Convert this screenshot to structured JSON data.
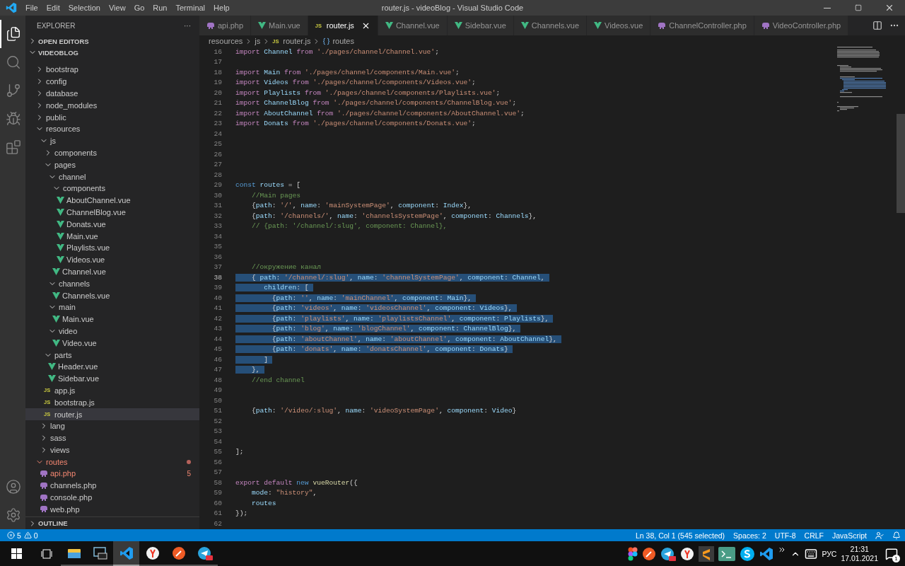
{
  "window": {
    "title": "router.js - videoBlog - Visual Studio Code"
  },
  "menu": [
    "File",
    "Edit",
    "Selection",
    "View",
    "Go",
    "Run",
    "Terminal",
    "Help"
  ],
  "activity_bar": [
    {
      "kind": "files",
      "selected": true
    },
    {
      "kind": "search",
      "selected": false
    },
    {
      "kind": "git",
      "selected": false
    },
    {
      "kind": "debug",
      "selected": false
    },
    {
      "kind": "extensions",
      "selected": false
    }
  ],
  "sidebar": {
    "title": "EXPLORER",
    "more": "···",
    "sections": [
      {
        "label": "OPEN EDITORS",
        "expanded": false
      },
      {
        "label": "VIDEOBLOG",
        "expanded": true
      }
    ],
    "tree": [
      {
        "label": "bootstrap",
        "kind": "folder",
        "expanded": false,
        "selected": false,
        "error": false
      },
      {
        "label": "config",
        "kind": "folder",
        "expanded": false,
        "selected": false,
        "error": false
      },
      {
        "label": "database",
        "kind": "folder",
        "expanded": false,
        "selected": false,
        "error": false
      },
      {
        "label": "node_modules",
        "kind": "folder",
        "expanded": false,
        "selected": false,
        "error": false
      },
      {
        "label": "public",
        "kind": "folder",
        "expanded": false,
        "selected": false,
        "error": false
      },
      {
        "label": "resources",
        "kind": "folder",
        "expanded": true,
        "selected": false,
        "error": false,
        "children": [
          {
            "label": "js",
            "kind": "folder",
            "expanded": true,
            "selected": false,
            "error": false,
            "children": [
              {
                "label": "components",
                "kind": "folder",
                "expanded": false,
                "selected": false,
                "error": false
              },
              {
                "label": "pages",
                "kind": "folder",
                "expanded": true,
                "selected": false,
                "error": false,
                "children": [
                  {
                    "label": "channel",
                    "kind": "folder",
                    "expanded": true,
                    "selected": false,
                    "error": false,
                    "children": [
                      {
                        "label": "components",
                        "kind": "folder",
                        "expanded": true,
                        "selected": false,
                        "error": false,
                        "children": [
                          {
                            "label": "AboutChannel.vue",
                            "kind": "vue",
                            "selected": false,
                            "error": false
                          },
                          {
                            "label": "ChannelBlog.vue",
                            "kind": "vue",
                            "selected": false,
                            "error": false
                          },
                          {
                            "label": "Donats.vue",
                            "kind": "vue",
                            "selected": false,
                            "error": false
                          },
                          {
                            "label": "Main.vue",
                            "kind": "vue",
                            "selected": false,
                            "error": false
                          },
                          {
                            "label": "Playlists.vue",
                            "kind": "vue",
                            "selected": false,
                            "error": false
                          },
                          {
                            "label": "Videos.vue",
                            "kind": "vue",
                            "selected": false,
                            "error": false
                          }
                        ]
                      },
                      {
                        "label": "Channel.vue",
                        "kind": "vue",
                        "selected": false,
                        "error": false
                      }
                    ]
                  },
                  {
                    "label": "channels",
                    "kind": "folder",
                    "expanded": true,
                    "selected": false,
                    "error": false,
                    "children": [
                      {
                        "label": "Channels.vue",
                        "kind": "vue",
                        "selected": false,
                        "error": false
                      }
                    ]
                  },
                  {
                    "label": "main",
                    "kind": "folder",
                    "expanded": true,
                    "selected": false,
                    "error": false,
                    "children": [
                      {
                        "label": "Main.vue",
                        "kind": "vue",
                        "selected": false,
                        "error": false
                      }
                    ]
                  },
                  {
                    "label": "video",
                    "kind": "folder",
                    "expanded": true,
                    "selected": false,
                    "error": false,
                    "children": [
                      {
                        "label": "Video.vue",
                        "kind": "vue",
                        "selected": false,
                        "error": false
                      }
                    ]
                  }
                ]
              },
              {
                "label": "parts",
                "kind": "folder",
                "expanded": true,
                "selected": false,
                "error": false,
                "children": [
                  {
                    "label": "Header.vue",
                    "kind": "vue",
                    "selected": false,
                    "error": false
                  },
                  {
                    "label": "Sidebar.vue",
                    "kind": "vue",
                    "selected": false,
                    "error": false
                  }
                ]
              },
              {
                "label": "app.js",
                "kind": "js",
                "icon": "JS",
                "selected": false,
                "error": false
              },
              {
                "label": "bootstrap.js",
                "kind": "js",
                "icon": "JS",
                "selected": false,
                "error": false
              },
              {
                "label": "router.js",
                "kind": "js",
                "icon": "JS",
                "selected": true,
                "error": false
              }
            ]
          },
          {
            "label": "lang",
            "kind": "folder",
            "expanded": false,
            "selected": false,
            "error": false
          },
          {
            "label": "sass",
            "kind": "folder",
            "expanded": false,
            "selected": false,
            "error": false
          },
          {
            "label": "views",
            "kind": "folder",
            "expanded": false,
            "selected": false,
            "error": false
          }
        ]
      },
      {
        "label": "routes",
        "kind": "folder",
        "expanded": true,
        "selected": false,
        "error": true,
        "children": [
          {
            "label": "api.php",
            "kind": "php",
            "selected": false,
            "error": true,
            "count": "5"
          },
          {
            "label": "channels.php",
            "kind": "php",
            "selected": false,
            "error": false
          },
          {
            "label": "console.php",
            "kind": "php",
            "selected": false,
            "error": false
          },
          {
            "label": "web.php",
            "kind": "php",
            "selected": false,
            "error": false
          }
        ]
      }
    ],
    "outline": {
      "label": "OUTLINE",
      "expanded": false
    }
  },
  "tabs": [
    {
      "label": "api.php",
      "kind": "php",
      "selected": false
    },
    {
      "label": "Main.vue",
      "kind": "vue",
      "selected": false
    },
    {
      "label": "router.js",
      "kind": "js",
      "icon": "JS",
      "selected": true
    },
    {
      "label": "Channel.vue",
      "kind": "vue",
      "selected": false
    },
    {
      "label": "Sidebar.vue",
      "kind": "vue",
      "selected": false
    },
    {
      "label": "Channels.vue",
      "kind": "vue",
      "selected": false
    },
    {
      "label": "Videos.vue",
      "kind": "vue",
      "selected": false
    },
    {
      "label": "ChannelController.php",
      "kind": "php",
      "selected": false
    },
    {
      "label": "VideoController.php",
      "kind": "php",
      "selected": false
    }
  ],
  "breadcrumb": [
    {
      "label": "resources",
      "kind": "folder"
    },
    {
      "label": "js",
      "kind": "folder"
    },
    {
      "label": "router.js",
      "kind": "js",
      "icon": "JS"
    },
    {
      "label": "routes",
      "kind": "symbol"
    }
  ],
  "code": [
    {
      "n": "16",
      "selected": false,
      "tokens": [
        {
          "kind": "k",
          "text": "import "
        },
        {
          "kind": "v",
          "text": "Channel "
        },
        {
          "kind": "k",
          "text": "from "
        },
        {
          "kind": "s",
          "text": "'./pages/channel/Channel.vue'"
        },
        {
          "kind": "p",
          "text": ";"
        }
      ]
    },
    {
      "n": "17",
      "selected": false
    },
    {
      "n": "18",
      "selected": false,
      "tokens": [
        {
          "kind": "k",
          "text": "import "
        },
        {
          "kind": "v",
          "text": "Main "
        },
        {
          "kind": "k",
          "text": "from "
        },
        {
          "kind": "s",
          "text": "'./pages/channel/components/Main.vue'"
        },
        {
          "kind": "p",
          "text": ";"
        }
      ]
    },
    {
      "n": "19",
      "selected": false,
      "tokens": [
        {
          "kind": "k",
          "text": "import "
        },
        {
          "kind": "v",
          "text": "Videos "
        },
        {
          "kind": "k",
          "text": "from "
        },
        {
          "kind": "s",
          "text": "'./pages/channel/components/Videos.vue'"
        },
        {
          "kind": "p",
          "text": ";"
        }
      ]
    },
    {
      "n": "20",
      "selected": false,
      "tokens": [
        {
          "kind": "k",
          "text": "import "
        },
        {
          "kind": "v",
          "text": "Playlists "
        },
        {
          "kind": "k",
          "text": "from "
        },
        {
          "kind": "s",
          "text": "'./pages/channel/components/Playlists.vue'"
        },
        {
          "kind": "p",
          "text": ";"
        }
      ]
    },
    {
      "n": "21",
      "selected": false,
      "tokens": [
        {
          "kind": "k",
          "text": "import "
        },
        {
          "kind": "v",
          "text": "ChannelBlog "
        },
        {
          "kind": "k",
          "text": "from "
        },
        {
          "kind": "s",
          "text": "'./pages/channel/components/ChannelBlog.vue'"
        },
        {
          "kind": "p",
          "text": ";"
        }
      ]
    },
    {
      "n": "22",
      "selected": false,
      "tokens": [
        {
          "kind": "k",
          "text": "import "
        },
        {
          "kind": "v",
          "text": "AboutChannel "
        },
        {
          "kind": "k",
          "text": "from "
        },
        {
          "kind": "s",
          "text": "'./pages/channel/components/AboutChannel.vue'"
        },
        {
          "kind": "p",
          "text": ";"
        }
      ]
    },
    {
      "n": "23",
      "selected": false,
      "tokens": [
        {
          "kind": "k",
          "text": "import "
        },
        {
          "kind": "v",
          "text": "Donats "
        },
        {
          "kind": "k",
          "text": "from "
        },
        {
          "kind": "s",
          "text": "'./pages/channel/components/Donats.vue'"
        },
        {
          "kind": "p",
          "text": ";"
        }
      ]
    },
    {
      "n": "24",
      "selected": false
    },
    {
      "n": "25",
      "selected": false
    },
    {
      "n": "26",
      "selected": false
    },
    {
      "n": "27",
      "selected": false
    },
    {
      "n": "28",
      "selected": false
    },
    {
      "n": "29",
      "selected": false,
      "tokens": [
        {
          "kind": "b",
          "text": "const "
        },
        {
          "kind": "v",
          "text": "routes "
        },
        {
          "kind": "p",
          "text": "= ["
        }
      ]
    },
    {
      "n": "30",
      "selected": false,
      "tokens": [
        {
          "kind": "c",
          "text": "    //Main pages"
        }
      ]
    },
    {
      "n": "31",
      "selected": false,
      "tokens": [
        {
          "kind": "p",
          "text": "    {"
        },
        {
          "kind": "v",
          "text": "path"
        },
        {
          "kind": "p",
          "text": ": "
        },
        {
          "kind": "s",
          "text": "'/'"
        },
        {
          "kind": "p",
          "text": ", "
        },
        {
          "kind": "v",
          "text": "name"
        },
        {
          "kind": "p",
          "text": ": "
        },
        {
          "kind": "s",
          "text": "'mainSystemPage'"
        },
        {
          "kind": "p",
          "text": ", "
        },
        {
          "kind": "v",
          "text": "component"
        },
        {
          "kind": "p",
          "text": ": "
        },
        {
          "kind": "v",
          "text": "Index"
        },
        {
          "kind": "p",
          "text": "},"
        }
      ]
    },
    {
      "n": "32",
      "selected": false,
      "tokens": [
        {
          "kind": "p",
          "text": "    {"
        },
        {
          "kind": "v",
          "text": "path"
        },
        {
          "kind": "p",
          "text": ": "
        },
        {
          "kind": "s",
          "text": "'/channels/'"
        },
        {
          "kind": "p",
          "text": ", "
        },
        {
          "kind": "v",
          "text": "name"
        },
        {
          "kind": "p",
          "text": ": "
        },
        {
          "kind": "s",
          "text": "'channelsSystemPage'"
        },
        {
          "kind": "p",
          "text": ", "
        },
        {
          "kind": "v",
          "text": "component"
        },
        {
          "kind": "p",
          "text": ": "
        },
        {
          "kind": "v",
          "text": "Channels"
        },
        {
          "kind": "p",
          "text": "},"
        }
      ]
    },
    {
      "n": "33",
      "selected": false,
      "tokens": [
        {
          "kind": "c",
          "text": "    // {path: '/channel/:slug', component: Channel},"
        }
      ]
    },
    {
      "n": "34",
      "selected": false
    },
    {
      "n": "35",
      "selected": false
    },
    {
      "n": "36",
      "selected": false
    },
    {
      "n": "37",
      "selected": false,
      "tokens": [
        {
          "kind": "c",
          "text": "    //окружение канал"
        }
      ]
    },
    {
      "n": "38",
      "selected": true,
      "tokens": [
        {
          "kind": "p",
          "text": "    { "
        },
        {
          "kind": "v",
          "text": "path"
        },
        {
          "kind": "p",
          "text": ": "
        },
        {
          "kind": "s",
          "text": "'/channel/:slug'"
        },
        {
          "kind": "p",
          "text": ", "
        },
        {
          "kind": "v",
          "text": "name"
        },
        {
          "kind": "p",
          "text": ": "
        },
        {
          "kind": "s",
          "text": "'channelSystemPage'"
        },
        {
          "kind": "p",
          "text": ", "
        },
        {
          "kind": "v",
          "text": "component"
        },
        {
          "kind": "p",
          "text": ": "
        },
        {
          "kind": "v",
          "text": "Channel"
        },
        {
          "kind": "p",
          "text": ","
        }
      ]
    },
    {
      "n": "39",
      "selected": true,
      "tokens": [
        {
          "kind": "v",
          "text": "       children"
        },
        {
          "kind": "p",
          "text": ": ["
        }
      ]
    },
    {
      "n": "40",
      "selected": true,
      "tokens": [
        {
          "kind": "p",
          "text": "         {"
        },
        {
          "kind": "v",
          "text": "path"
        },
        {
          "kind": "p",
          "text": ": "
        },
        {
          "kind": "s",
          "text": "''"
        },
        {
          "kind": "p",
          "text": ", "
        },
        {
          "kind": "v",
          "text": "name"
        },
        {
          "kind": "p",
          "text": ": "
        },
        {
          "kind": "s",
          "text": "'mainChannel'"
        },
        {
          "kind": "p",
          "text": ", "
        },
        {
          "kind": "v",
          "text": "component"
        },
        {
          "kind": "p",
          "text": ": "
        },
        {
          "kind": "v",
          "text": "Main"
        },
        {
          "kind": "p",
          "text": "},"
        }
      ]
    },
    {
      "n": "41",
      "selected": true,
      "tokens": [
        {
          "kind": "p",
          "text": "         {"
        },
        {
          "kind": "v",
          "text": "path"
        },
        {
          "kind": "p",
          "text": ": "
        },
        {
          "kind": "s",
          "text": "'videos'"
        },
        {
          "kind": "p",
          "text": ", "
        },
        {
          "kind": "v",
          "text": "name"
        },
        {
          "kind": "p",
          "text": ": "
        },
        {
          "kind": "s",
          "text": "'videosChannel'"
        },
        {
          "kind": "p",
          "text": ", "
        },
        {
          "kind": "v",
          "text": "component"
        },
        {
          "kind": "p",
          "text": ": "
        },
        {
          "kind": "v",
          "text": "Videos"
        },
        {
          "kind": "p",
          "text": "},"
        }
      ]
    },
    {
      "n": "42",
      "selected": true,
      "tokens": [
        {
          "kind": "p",
          "text": "         {"
        },
        {
          "kind": "v",
          "text": "path"
        },
        {
          "kind": "p",
          "text": ": "
        },
        {
          "kind": "s",
          "text": "'playlists'"
        },
        {
          "kind": "p",
          "text": ", "
        },
        {
          "kind": "v",
          "text": "name"
        },
        {
          "kind": "p",
          "text": ": "
        },
        {
          "kind": "s",
          "text": "'playlistsChannel'"
        },
        {
          "kind": "p",
          "text": ", "
        },
        {
          "kind": "v",
          "text": "component"
        },
        {
          "kind": "p",
          "text": ": "
        },
        {
          "kind": "v",
          "text": "Playlists"
        },
        {
          "kind": "p",
          "text": "},"
        }
      ]
    },
    {
      "n": "43",
      "selected": true,
      "tokens": [
        {
          "kind": "p",
          "text": "         {"
        },
        {
          "kind": "v",
          "text": "path"
        },
        {
          "kind": "p",
          "text": ": "
        },
        {
          "kind": "s",
          "text": "'blog'"
        },
        {
          "kind": "p",
          "text": ", "
        },
        {
          "kind": "v",
          "text": "name"
        },
        {
          "kind": "p",
          "text": ": "
        },
        {
          "kind": "s",
          "text": "'blogChannel'"
        },
        {
          "kind": "p",
          "text": ", "
        },
        {
          "kind": "v",
          "text": "component"
        },
        {
          "kind": "p",
          "text": ": "
        },
        {
          "kind": "v",
          "text": "ChannelBlog"
        },
        {
          "kind": "p",
          "text": "},"
        }
      ]
    },
    {
      "n": "44",
      "selected": true,
      "tokens": [
        {
          "kind": "p",
          "text": "         {"
        },
        {
          "kind": "v",
          "text": "path"
        },
        {
          "kind": "p",
          "text": ": "
        },
        {
          "kind": "s",
          "text": "'aboutChannel'"
        },
        {
          "kind": "p",
          "text": ", "
        },
        {
          "kind": "v",
          "text": "name"
        },
        {
          "kind": "p",
          "text": ": "
        },
        {
          "kind": "s",
          "text": "'aboutChannel'"
        },
        {
          "kind": "p",
          "text": ", "
        },
        {
          "kind": "v",
          "text": "component"
        },
        {
          "kind": "p",
          "text": ": "
        },
        {
          "kind": "v",
          "text": "AboutChannel"
        },
        {
          "kind": "p",
          "text": "},"
        }
      ]
    },
    {
      "n": "45",
      "selected": true,
      "tokens": [
        {
          "kind": "p",
          "text": "         {"
        },
        {
          "kind": "v",
          "text": "path"
        },
        {
          "kind": "p",
          "text": ": "
        },
        {
          "kind": "s",
          "text": "'donats'"
        },
        {
          "kind": "p",
          "text": ", "
        },
        {
          "kind": "v",
          "text": "name"
        },
        {
          "kind": "p",
          "text": ": "
        },
        {
          "kind": "s",
          "text": "'donatsChannel'"
        },
        {
          "kind": "p",
          "text": ", "
        },
        {
          "kind": "v",
          "text": "component"
        },
        {
          "kind": "p",
          "text": ": "
        },
        {
          "kind": "v",
          "text": "Donats"
        },
        {
          "kind": "p",
          "text": "}"
        }
      ]
    },
    {
      "n": "46",
      "selected": true,
      "tokens": [
        {
          "kind": "p",
          "text": "       ]"
        }
      ]
    },
    {
      "n": "47",
      "selected": true,
      "tokens": [
        {
          "kind": "p",
          "text": "    },"
        }
      ]
    },
    {
      "n": "48",
      "selected": false,
      "tokens": [
        {
          "kind": "c",
          "text": "    //end channel"
        }
      ]
    },
    {
      "n": "49",
      "selected": false
    },
    {
      "n": "50",
      "selected": false
    },
    {
      "n": "51",
      "selected": false,
      "tokens": [
        {
          "kind": "p",
          "text": "    {"
        },
        {
          "kind": "v",
          "text": "path"
        },
        {
          "kind": "p",
          "text": ": "
        },
        {
          "kind": "s",
          "text": "'/video/:slug'"
        },
        {
          "kind": "p",
          "text": ", "
        },
        {
          "kind": "v",
          "text": "name"
        },
        {
          "kind": "p",
          "text": ": "
        },
        {
          "kind": "s",
          "text": "'videoSystemPage'"
        },
        {
          "kind": "p",
          "text": ", "
        },
        {
          "kind": "v",
          "text": "component"
        },
        {
          "kind": "p",
          "text": ": "
        },
        {
          "kind": "v",
          "text": "Video"
        },
        {
          "kind": "p",
          "text": "}"
        }
      ]
    },
    {
      "n": "52",
      "selected": false
    },
    {
      "n": "53",
      "selected": false
    },
    {
      "n": "54",
      "selected": false
    },
    {
      "n": "55",
      "selected": false,
      "tokens": [
        {
          "kind": "p",
          "text": "];"
        }
      ]
    },
    {
      "n": "56",
      "selected": false
    },
    {
      "n": "57",
      "selected": false
    },
    {
      "n": "58",
      "selected": false,
      "tokens": [
        {
          "kind": "k",
          "text": "export default "
        },
        {
          "kind": "b",
          "text": "new "
        },
        {
          "kind": "f",
          "text": "vueRouter"
        },
        {
          "kind": "p",
          "text": "({"
        }
      ]
    },
    {
      "n": "59",
      "selected": false,
      "tokens": [
        {
          "kind": "v",
          "text": "    mode"
        },
        {
          "kind": "p",
          "text": ": "
        },
        {
          "kind": "s",
          "text": "\"history\""
        },
        {
          "kind": "p",
          "text": ","
        }
      ]
    },
    {
      "n": "60",
      "selected": false,
      "tokens": [
        {
          "kind": "v",
          "text": "    routes"
        }
      ]
    },
    {
      "n": "61",
      "selected": false,
      "tokens": [
        {
          "kind": "p",
          "text": "});"
        }
      ]
    },
    {
      "n": "62",
      "selected": false
    }
  ],
  "status_bar": {
    "errors": "5",
    "warnings": "0",
    "items": [
      "Ln 38, Col 1 (545 selected)",
      "Spaces: 2",
      "UTF-8",
      "CRLF",
      "JavaScript"
    ]
  },
  "taskbar": {
    "apps": [
      {
        "kind": "explorer",
        "active": false
      },
      {
        "kind": "console",
        "active": false
      },
      {
        "kind": "vscode",
        "active": true
      },
      {
        "kind": "yandex",
        "active": false
      },
      {
        "kind": "postman",
        "active": false
      },
      {
        "kind": "telegram",
        "active": false
      }
    ],
    "tray_apps": [
      {
        "kind": "figma"
      },
      {
        "kind": "postman"
      },
      {
        "kind": "telegram"
      },
      {
        "kind": "yandex"
      },
      {
        "kind": "sublime"
      },
      {
        "kind": "terminal"
      },
      {
        "kind": "skype"
      },
      {
        "kind": "vscode"
      }
    ],
    "language": "РУС",
    "time": "21:31",
    "date": "17.01.2021",
    "notifications": "1"
  }
}
